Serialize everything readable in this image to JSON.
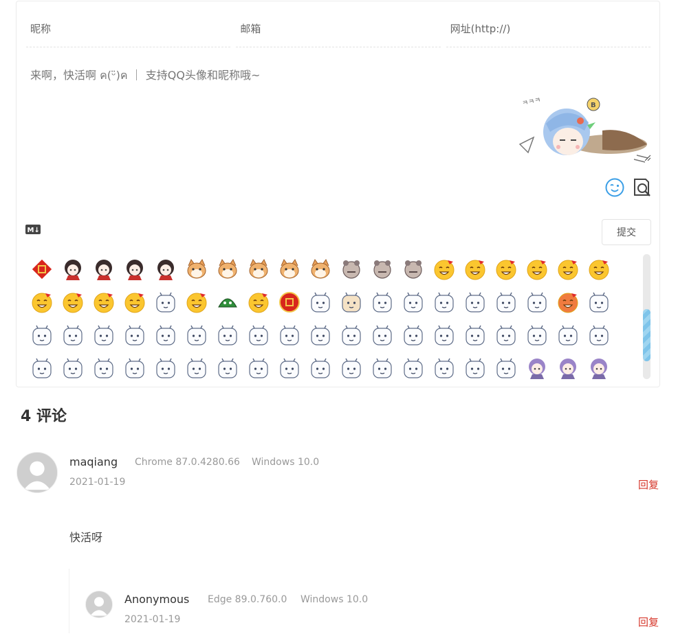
{
  "form": {
    "nick_placeholder": "昵称",
    "mail_placeholder": "邮箱",
    "link_placeholder": "网址(http://)",
    "content_placeholder": "来啊，快活啊 ค(ᵕ̈)ค ｜ 支持QQ头像和昵称哦~",
    "submit_label": "提交",
    "markdown_badge": "M↓",
    "mascot_scribble": "ㅋㅋㅋ"
  },
  "emoji": {
    "rows": 4,
    "columns": 19,
    "last_row_count": 19
  },
  "comments_title": "4 评论",
  "comments": [
    {
      "nick": "maqiang",
      "browser": "Chrome 87.0.4280.66",
      "os": "Windows 10.0",
      "date": "2021-01-19",
      "reply_label": "回复",
      "content": "快活呀"
    },
    {
      "nick": "Anonymous",
      "browser": "Edge 89.0.760.0",
      "os": "Windows 10.0",
      "date": "2021-01-19",
      "reply_label": "回复"
    }
  ],
  "colors": {
    "accent_reply": "#d6372b",
    "scroll_thumb": "#8ccbee",
    "border": "#ebebeb"
  }
}
